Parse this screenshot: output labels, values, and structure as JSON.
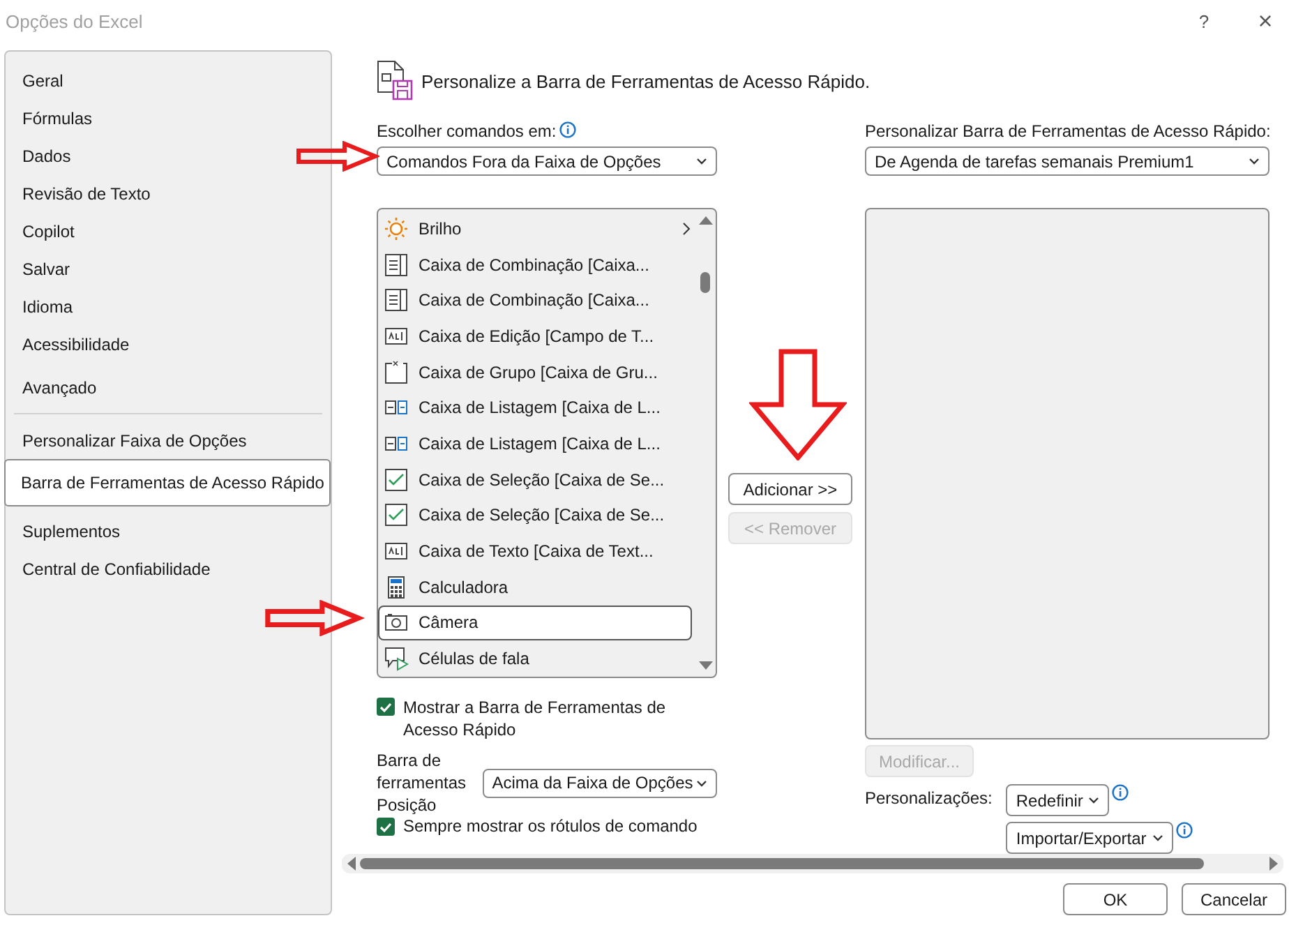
{
  "window": {
    "title": "Opções do Excel",
    "help": "?",
    "close": "×"
  },
  "sidebar": {
    "groups": [
      [
        {
          "label": "Geral",
          "selected": false
        },
        {
          "label": "Fórmulas",
          "selected": false
        },
        {
          "label": "Dados",
          "selected": false
        },
        {
          "label": "Revisão de Texto",
          "selected": false
        },
        {
          "label": "Copilot",
          "selected": false
        },
        {
          "label": "Salvar",
          "selected": false
        },
        {
          "label": "Idioma",
          "selected": false
        },
        {
          "label": "Acessibilidade",
          "selected": false
        }
      ],
      [
        {
          "label": "Avançado",
          "selected": false
        }
      ],
      [
        {
          "label": "Personalizar Faixa de Opções",
          "selected": false
        },
        {
          "label": "Barra de Ferramentas de Acesso Rápido",
          "selected": true
        }
      ],
      [
        {
          "label": "Suplementos",
          "selected": false
        },
        {
          "label": "Central de Confiabilidade",
          "selected": false
        }
      ]
    ]
  },
  "header": {
    "title": "Personalize a Barra de Ferramentas de Acesso Rápido."
  },
  "left": {
    "label": "Escolher comandos em:",
    "dropdown": "Comandos Fora da Faixa de Opções",
    "commands": [
      {
        "kind": "brightness",
        "label": "Brilho",
        "submenu": true,
        "selected": false
      },
      {
        "kind": "combo",
        "label": "Caixa de Combinação [Caixa...",
        "submenu": false,
        "selected": false
      },
      {
        "kind": "combo",
        "label": "Caixa de Combinação [Caixa...",
        "submenu": false,
        "selected": false
      },
      {
        "kind": "edit",
        "label": "Caixa de Edição [Campo de T...",
        "submenu": false,
        "selected": false
      },
      {
        "kind": "group",
        "label": "Caixa de Grupo [Caixa de Gru...",
        "submenu": false,
        "selected": false
      },
      {
        "kind": "listbox",
        "label": "Caixa de Listagem [Caixa de L...",
        "submenu": false,
        "selected": false
      },
      {
        "kind": "listbox",
        "label": "Caixa de Listagem [Caixa de L...",
        "submenu": false,
        "selected": false
      },
      {
        "kind": "checkbox",
        "label": "Caixa de Seleção [Caixa de Se...",
        "submenu": false,
        "selected": false
      },
      {
        "kind": "checkbox",
        "label": "Caixa de Seleção [Caixa de Se...",
        "submenu": false,
        "selected": false
      },
      {
        "kind": "edit",
        "label": "Caixa de Texto [Caixa de Text...",
        "submenu": false,
        "selected": false
      },
      {
        "kind": "calculator",
        "label": "Calculadora",
        "submenu": false,
        "selected": false
      },
      {
        "kind": "camera",
        "label": "Câmera",
        "submenu": false,
        "selected": true
      },
      {
        "kind": "callout",
        "label": "Células de fala",
        "submenu": false,
        "selected": false
      }
    ],
    "show_toolbar": {
      "label": "Mostrar a Barra de Ferramentas de Acesso Rápido",
      "checked": true
    },
    "position": {
      "label": "Barra de ferramentas Posição",
      "value": "Acima da Faixa de Opções"
    },
    "always_show_labels": {
      "label": "Sempre mostrar os rótulos de comando",
      "checked": true
    }
  },
  "middle": {
    "buttons": [
      {
        "label": "Adicionar >>",
        "disabled": false
      },
      {
        "label": "<< Remover",
        "disabled": true
      }
    ]
  },
  "right": {
    "label": "Personalizar Barra de Ferramentas de Acesso Rápido:",
    "dropdown": "De Agenda de tarefas semanais Premium1",
    "modify": {
      "label": "Modificar...",
      "disabled": true
    },
    "customizations_label": "Personalizações:",
    "reset": "Redefinir",
    "import_export": "Importar/Exportar"
  },
  "footer": {
    "buttons": [
      "OK",
      "Cancelar"
    ]
  },
  "annotations": [
    {
      "kind": "right-arrow"
    },
    {
      "kind": "down-arrow"
    },
    {
      "kind": "right-arrow"
    }
  ]
}
